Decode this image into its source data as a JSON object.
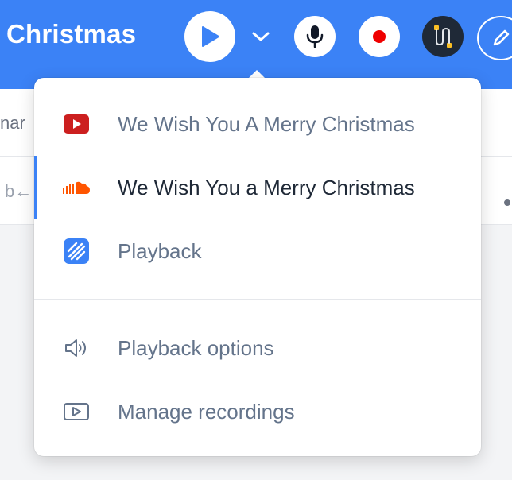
{
  "header": {
    "title": "Christmas",
    "accent_color": "#3b82f6",
    "buttons": {
      "play": "play-icon",
      "expand": "chevron-down-icon",
      "mic": "microphone-icon",
      "record": "record-icon",
      "cable": "cable-icon",
      "edit": "pencil-icon"
    }
  },
  "background": {
    "text_1": "nar",
    "text_2": "b←"
  },
  "menu": {
    "sources": [
      {
        "label": "We Wish You A Merry Christmas",
        "icon": "youtube-icon",
        "active": false
      },
      {
        "label": "We Wish You a Merry Christmas",
        "icon": "soundcloud-icon",
        "active": true
      },
      {
        "label": "Playback",
        "icon": "playback-logo-icon",
        "active": false
      }
    ],
    "actions": [
      {
        "label": "Playback options",
        "icon": "speaker-icon"
      },
      {
        "label": "Manage recordings",
        "icon": "video-play-icon"
      }
    ]
  }
}
